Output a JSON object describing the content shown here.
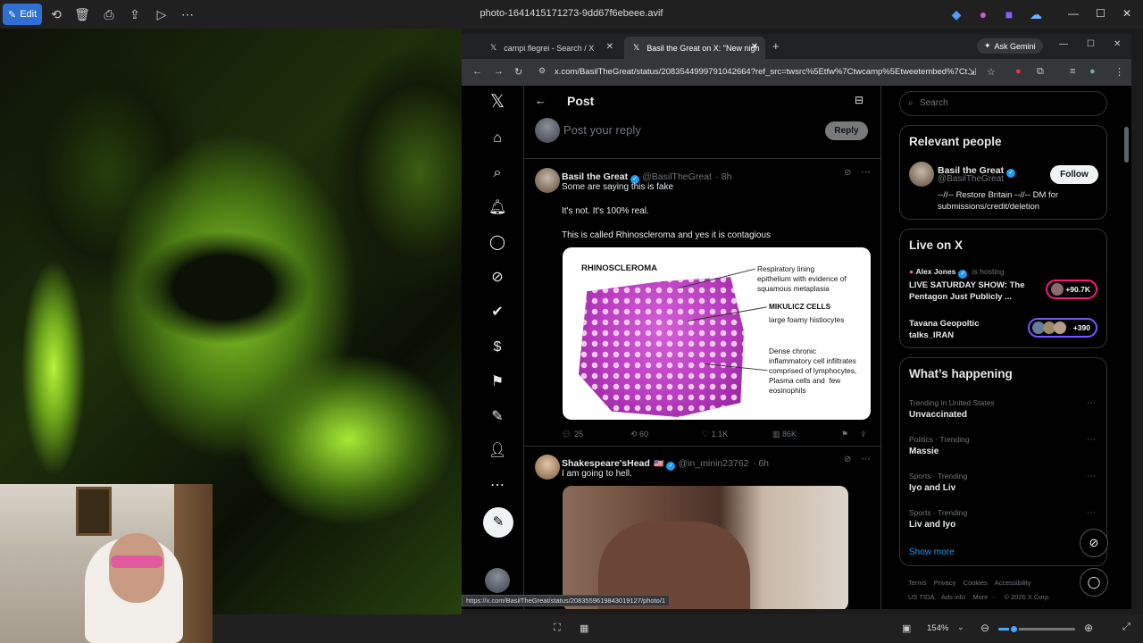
{
  "viewer": {
    "edit_label": "Edit",
    "title": "photo-1641415171273-9dd67f6ebeee.avif",
    "zoom": "154%",
    "zoom_fraction": 0.2
  },
  "browser": {
    "tabs": [
      {
        "label": "campi flegrei - Search / X"
      },
      {
        "label": "Basil the Great on X: \"New nigh"
      }
    ],
    "gemini_label": "Ask Gemini",
    "url": "x.com/BasilTheGreat/status/2083544999791042664?ref_src=twsrc%5Etfw%7Ctwcamp%5Etweetembed%7Ct...",
    "status_link": "https://x.com/BasilTheGreat/status/2083559619843019127/photo/1"
  },
  "x": {
    "header_title": "Post",
    "reply_placeholder": "Post your reply",
    "reply_button": "Reply",
    "tweet1": {
      "name": "Basil the Great",
      "handle": "@BasilTheGreat",
      "time": "· 8h",
      "lines": [
        "Some are saying this is fake",
        "It's not. It's 100% real.",
        "This is called Rhinoscleroma and yes it is contagious"
      ],
      "replies": "25",
      "reposts": "60",
      "likes": "1.1K",
      "views": "86K"
    },
    "rhino_image": {
      "title": "RHINOSCLEROMA",
      "label1": "Respiratory lining\nepithelium with evidence of\nsquamous metaplasia",
      "label2_title": "MIKULICZ CELLS",
      "label2": "large  foamy histiocytes",
      "label3": "Dense chronic\ninflammatory cell infiltrates\ncomprised of lymphocytes,\nPlasma cells and  few\neosinophils"
    },
    "tweet2": {
      "name": "Shakespeare'sHead",
      "flag": "🇺🇸",
      "handle": "@in_minin23762",
      "time": "· 6h",
      "text": "I am going to hell."
    },
    "search_placeholder": "Search",
    "relevant": {
      "heading": "Relevant people",
      "name": "Basil the Great",
      "handle": "@BasilTheGreat",
      "follow": "Follow",
      "bio": "--//-- Restore Britain --//-- DM for submissions/credit/deletion"
    },
    "live": {
      "heading": "Live on X",
      "host_name": "Alex Jones",
      "host_suffix": "is hosting",
      "show1": "LIVE SATURDAY SHOW: The Pentagon Just Publicly ...",
      "show1_count": "+90.7K",
      "show2": "Tavana Geopoltic talks_IRAN",
      "show2_count": "+390"
    },
    "happening": {
      "heading": "What’s happening",
      "trends": [
        {
          "cat": "Trending in United States",
          "name": "Unvaccinated"
        },
        {
          "cat": "Politics · Trending",
          "name": "Massie"
        },
        {
          "cat": "Sports · Trending",
          "name": "Iyo and Liv"
        },
        {
          "cat": "Sports · Trending",
          "name": "Liv and Iyo"
        }
      ],
      "show_more": "Show more"
    },
    "footer": {
      "line1": "Terms    Privacy    Cookies    Accessibility",
      "line2": "US TIDA    Ads info    More ···    © 2026 X Corp."
    }
  },
  "colors": {
    "x_blue": "#1d9bf0",
    "viewer_accent": "#2f6fd1",
    "live_pill_1": "#f91880",
    "live_pill_2": "#7856ff"
  }
}
